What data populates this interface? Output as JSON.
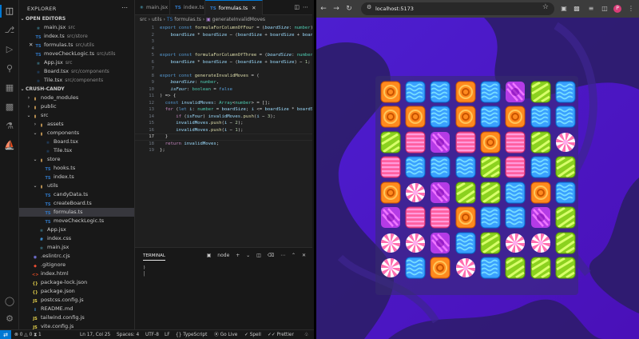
{
  "activity_bar": {
    "icons": [
      "files-icon",
      "search-icon",
      "source-control-icon",
      "run-debug-icon",
      "extensions-icon",
      "remote-explorer-icon",
      "testing-icon",
      "docker-icon",
      "account-icon",
      "manage-gear-icon"
    ]
  },
  "sidebar": {
    "title": "EXPLORER",
    "open_editors_label": "OPEN EDITORS",
    "open_editors": [
      {
        "name": "main.jsx",
        "desc": "src",
        "icon": "jsx"
      },
      {
        "name": "index.ts",
        "desc": "src/store",
        "icon": "ts"
      },
      {
        "name": "formulas.ts",
        "desc": "src/utils",
        "icon": "ts",
        "active": true
      },
      {
        "name": "moveCheckLogic.ts",
        "desc": "src/utils",
        "icon": "ts"
      },
      {
        "name": "App.jsx",
        "desc": "src",
        "icon": "jsx"
      },
      {
        "name": "Board.tsx",
        "desc": "src/components",
        "icon": "tsx"
      },
      {
        "name": "Tile.tsx",
        "desc": "src/components",
        "icon": "tsx"
      }
    ],
    "project_label": "CRUSH-CANDY",
    "tree": [
      {
        "name": "node_modules",
        "depth": 1,
        "type": "folder",
        "open": false
      },
      {
        "name": "public",
        "depth": 1,
        "type": "folder",
        "open": false
      },
      {
        "name": "src",
        "depth": 1,
        "type": "folder",
        "open": true
      },
      {
        "name": "assets",
        "depth": 2,
        "type": "folder",
        "open": false
      },
      {
        "name": "components",
        "depth": 2,
        "type": "folder",
        "open": true
      },
      {
        "name": "Board.tsx",
        "depth": 3,
        "type": "tsx"
      },
      {
        "name": "Tile.tsx",
        "depth": 3,
        "type": "tsx"
      },
      {
        "name": "store",
        "depth": 2,
        "type": "folder",
        "open": true
      },
      {
        "name": "hooks.ts",
        "depth": 3,
        "type": "ts"
      },
      {
        "name": "index.ts",
        "depth": 3,
        "type": "ts"
      },
      {
        "name": "utils",
        "depth": 2,
        "type": "folder",
        "open": true
      },
      {
        "name": "candyData.ts",
        "depth": 3,
        "type": "ts"
      },
      {
        "name": "createBoard.ts",
        "depth": 3,
        "type": "ts"
      },
      {
        "name": "formulas.ts",
        "depth": 3,
        "type": "ts",
        "selected": true
      },
      {
        "name": "moveCheckLogic.ts",
        "depth": 3,
        "type": "ts"
      },
      {
        "name": "App.jsx",
        "depth": 2,
        "type": "jsx"
      },
      {
        "name": "index.css",
        "depth": 2,
        "type": "css"
      },
      {
        "name": "main.jsx",
        "depth": 2,
        "type": "jsx"
      },
      {
        "name": ".eslintrc.cjs",
        "depth": 1,
        "type": "eslint"
      },
      {
        "name": ".gitignore",
        "depth": 1,
        "type": "git"
      },
      {
        "name": "index.html",
        "depth": 1,
        "type": "html"
      },
      {
        "name": "package-lock.json",
        "depth": 1,
        "type": "json"
      },
      {
        "name": "package.json",
        "depth": 1,
        "type": "json"
      },
      {
        "name": "postcss.config.js",
        "depth": 1,
        "type": "js"
      },
      {
        "name": "README.md",
        "depth": 1,
        "type": "md"
      },
      {
        "name": "tailwind.config.js",
        "depth": 1,
        "type": "js"
      },
      {
        "name": "vite.config.js",
        "depth": 1,
        "type": "js"
      }
    ]
  },
  "editor": {
    "tabs": [
      {
        "label": "main.jsx",
        "icon": "jsx",
        "active": false
      },
      {
        "label": "index.ts",
        "icon": "ts",
        "active": false
      },
      {
        "label": "formulas.ts",
        "icon": "ts",
        "active": true
      }
    ],
    "breadcrumb": [
      "src",
      "utils",
      "formulas.ts",
      "generateInvalidMoves"
    ],
    "current_line": 17
  },
  "terminal": {
    "tab_label": "TERMINAL",
    "shell": "node",
    "lines": [
      ")",
      "│"
    ]
  },
  "statusbar": {
    "errors": "0",
    "warnings": "0",
    "ports": "1",
    "position": "Ln 17, Col 25",
    "spaces": "Spaces: 4",
    "encoding": "UTF-8",
    "eol": "LF",
    "language": "TypeScript",
    "go_live": "Go Live",
    "spell": "Spell",
    "prettier": "Prettier"
  },
  "browser": {
    "url": "localhost:5173"
  },
  "game": {
    "board": [
      [
        "orange",
        "blue",
        "blue",
        "orange",
        "blue",
        "purple",
        "lime",
        "blue"
      ],
      [
        "orange",
        "orange",
        "blue",
        "orange",
        "blue",
        "orange",
        "blue",
        "blue"
      ],
      [
        "lime",
        "pink",
        "purple",
        "pink",
        "orange",
        "pink",
        "lime",
        "pinkswirl"
      ],
      [
        "pink",
        "blue",
        "blue",
        "blue",
        "lime",
        "pink",
        "blue",
        "lime"
      ],
      [
        "orange",
        "pinkswirl",
        "purple",
        "lime",
        "lime",
        "blue",
        "orange",
        "blue"
      ],
      [
        "purple",
        "pink",
        "pink",
        "orange",
        "blue",
        "blue",
        "purple",
        "lime"
      ],
      [
        "pinkswirl",
        "pinkswirl",
        "purple",
        "blue",
        "lime",
        "pinkswirl",
        "pinkswirl",
        "lime"
      ],
      [
        "pinkswirl",
        "blue",
        "orange",
        "pinkswirl",
        "blue",
        "lime",
        "lime",
        "lime"
      ]
    ],
    "candy_colors": {
      "orange": "#ff8a1e",
      "blue": "#3aa0ff",
      "lime": "#8bd11f",
      "pink": "#ff5fa0",
      "purple": "#b43be6",
      "pinkswirl": "#ff6fb0"
    }
  }
}
